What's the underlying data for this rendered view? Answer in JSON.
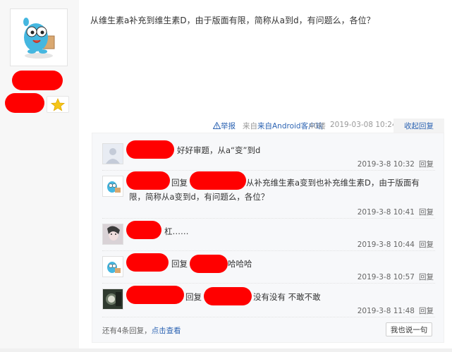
{
  "post": {
    "text": "从维生素a补充到维生素D，由于版面有限，简称从a到d，有问题么，各位？"
  },
  "meta": {
    "report_icon": "warning-triangle-icon",
    "report_label": "举报",
    "source": "来自Android客户端",
    "floor": "40楼",
    "datetime": "2019-03-08 10:24",
    "collapse_label": "收起回复"
  },
  "replies": [
    {
      "text": "好好审题，从a“变”到d",
      "time": "2019-3-8 10:32",
      "reply_label": "回复"
    },
    {
      "prefix": "回复",
      "text_line1": "从补充维生素a变到也补充维生素D，由于版面有",
      "text_line2": "限，简称从a变到d，有问题么，各位？",
      "time": "2019-3-8 10:41",
      "reply_label": "回复"
    },
    {
      "text": "杠……",
      "time": "2019-3-8 10:44",
      "reply_label": "回复"
    },
    {
      "prefix": "回复",
      "text": "哈哈哈",
      "time": "2019-3-8 10:57",
      "reply_label": "回复"
    },
    {
      "prefix": "回复",
      "text": "没有没有 不敢不敢",
      "time": "2019-3-8 11:48",
      "reply_label": "回复"
    }
  ],
  "footer": {
    "more_prefix": "还有4条回复，",
    "more_link": "点击查看",
    "say_button": "我也说一句"
  },
  "colors": {
    "link": "#2d64b3",
    "redaction": "#ff0000"
  }
}
